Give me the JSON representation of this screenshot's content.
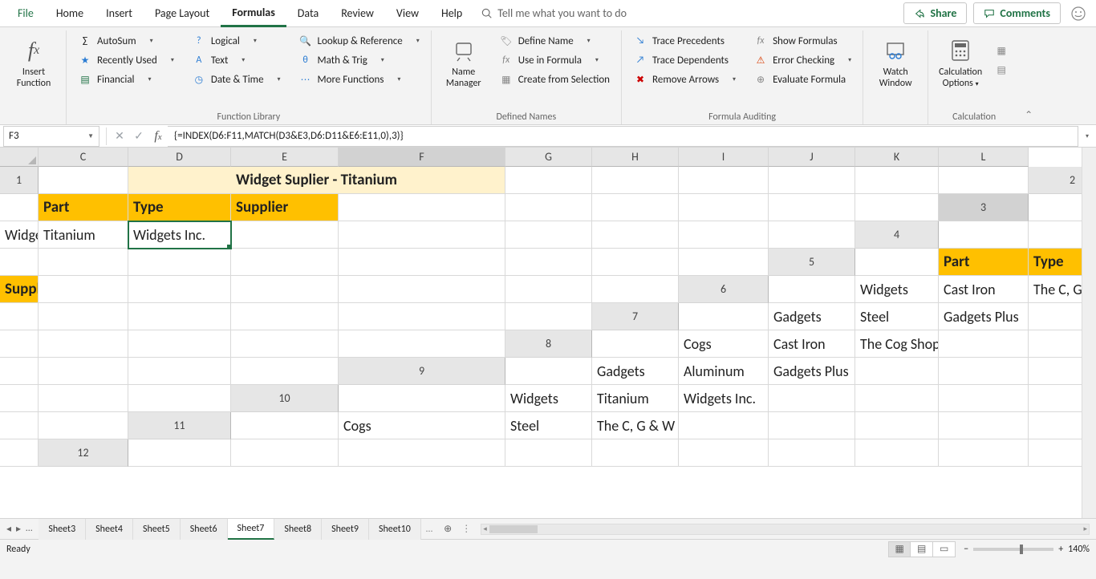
{
  "menu": {
    "tabs": [
      "File",
      "Home",
      "Insert",
      "Page Layout",
      "Formulas",
      "Data",
      "Review",
      "View",
      "Help"
    ],
    "active": "Formulas",
    "tellme": "Tell me what you want to do",
    "share": "Share",
    "comments": "Comments"
  },
  "ribbon": {
    "insertFunction": "Insert Function",
    "functionLibrary": {
      "label": "Function Library",
      "col1": [
        "AutoSum",
        "Recently Used",
        "Financial"
      ],
      "col2": [
        "Logical",
        "Text",
        "Date & Time"
      ],
      "col3": [
        "Lookup & Reference",
        "Math & Trig",
        "More Functions"
      ]
    },
    "definedNames": {
      "label": "Defined Names",
      "big": "Name Manager",
      "items": [
        "Define Name",
        "Use in Formula",
        "Create from Selection"
      ]
    },
    "auditing": {
      "label": "Formula Auditing",
      "left": [
        "Trace Precedents",
        "Trace Dependents",
        "Remove Arrows"
      ],
      "right": [
        "Show Formulas",
        "Error Checking",
        "Evaluate Formula"
      ]
    },
    "watch": "Watch Window",
    "calc": {
      "label": "Calculation",
      "big": "Calculation Options"
    }
  },
  "fbar": {
    "namebox": "F3",
    "formula": "{=INDEX(D6:F11,MATCH(D3&E3,D6:D11&E6:E11,0),3)}"
  },
  "columns": [
    "C",
    "D",
    "E",
    "F",
    "G",
    "H",
    "I",
    "J",
    "K",
    "L"
  ],
  "rows": [
    "1",
    "2",
    "3",
    "4",
    "5",
    "6",
    "7",
    "8",
    "9",
    "10",
    "11",
    "12"
  ],
  "selected": {
    "row": "3",
    "col": "F"
  },
  "titleCell": "Widget Suplier - Titanium",
  "headers1": {
    "part": "Part",
    "type": "Type",
    "supplier": "Supplier"
  },
  "lookup": {
    "part": "Widgets",
    "type": "Titanium",
    "supplier": "Widgets Inc."
  },
  "headers2": {
    "part": "Part",
    "type": "Type",
    "supplier": "Suppliler"
  },
  "table": [
    {
      "part": "Widgets",
      "type": "Cast Iron",
      "supplier": "The C, G & W Co."
    },
    {
      "part": "Gadgets",
      "type": "Steel",
      "supplier": "Gadgets Plus"
    },
    {
      "part": "Cogs",
      "type": "Cast Iron",
      "supplier": "The Cog Shop"
    },
    {
      "part": "Gadgets",
      "type": "Aluminum",
      "supplier": "Gadgets Plus"
    },
    {
      "part": "Widgets",
      "type": "Titanium",
      "supplier": "Widgets Inc."
    },
    {
      "part": "Cogs",
      "type": "Steel",
      "supplier": "The C, G & W Co."
    }
  ],
  "sheets": {
    "list": [
      "Sheet3",
      "Sheet4",
      "Sheet5",
      "Sheet6",
      "Sheet7",
      "Sheet8",
      "Sheet9",
      "Sheet10"
    ],
    "active": "Sheet7"
  },
  "status": {
    "ready": "Ready",
    "zoom": "140%"
  }
}
